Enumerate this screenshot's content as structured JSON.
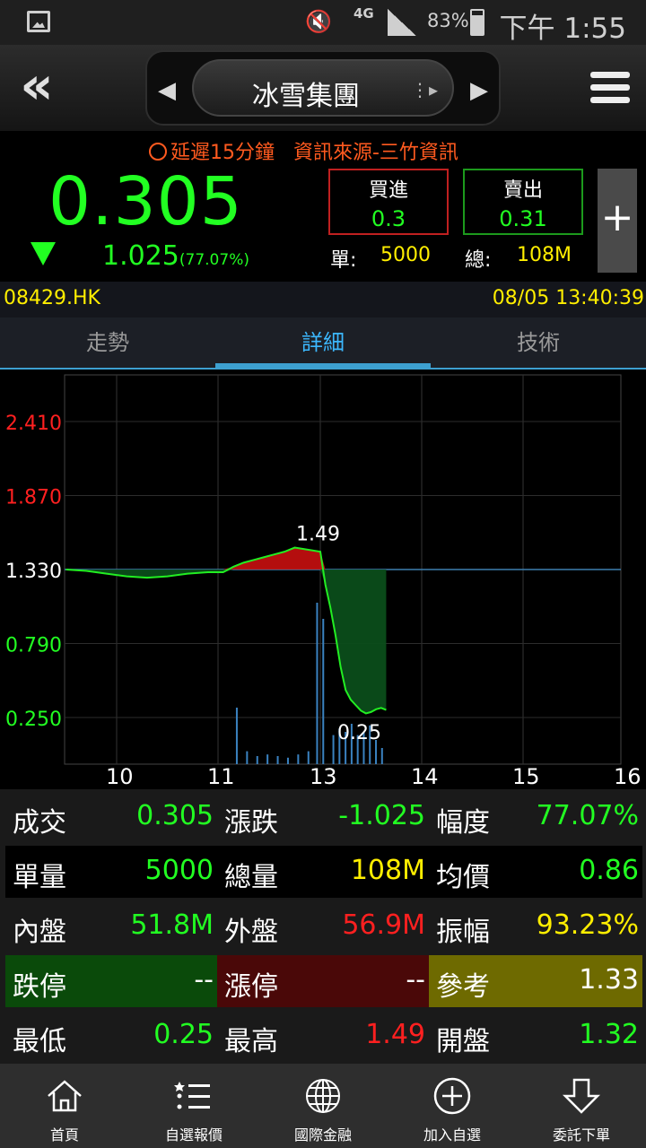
{
  "status_bar": {
    "network": "4G",
    "battery": "83%",
    "time": "下午 1:55"
  },
  "nav": {
    "title": "冰雪集團"
  },
  "quote": {
    "delay_note": "延遲15分鐘",
    "source_note": "資訊來源-三竹資訊",
    "price": "0.305",
    "change": "1.025",
    "change_pct": "(77.07%)",
    "buy_label": "買進",
    "buy_value": "0.3",
    "sell_label": "賣出",
    "sell_value": "0.31",
    "lot_label": "單:",
    "lot_value": "5000",
    "total_label": "總:",
    "total_value": "108M",
    "plus": "+"
  },
  "code_row": {
    "code": "08429.HK",
    "datetime": "08/05 13:40:39"
  },
  "tabs": [
    {
      "label": "走勢",
      "active": false
    },
    {
      "label": "詳細",
      "active": true
    },
    {
      "label": "技術",
      "active": false
    }
  ],
  "chart_data": {
    "type": "line",
    "y_ticks": [
      "2.410",
      "1.870",
      "1.330",
      "0.790",
      "0.250"
    ],
    "y_tick_colors": [
      "#ff2020",
      "#ff2020",
      "#ffffff",
      "#22ff22",
      "#22ff22"
    ],
    "x_ticks": [
      "10",
      "11",
      "13",
      "14",
      "15",
      "16"
    ],
    "ylim": [
      0.25,
      2.41
    ],
    "reference": 1.33,
    "high_label": "1.49",
    "low_label": "0.25",
    "price_series": {
      "x": [
        9.5,
        9.7,
        9.9,
        10.1,
        10.3,
        10.5,
        10.7,
        10.9,
        11.1,
        11.3,
        11.5,
        11.7,
        11.9,
        12.1,
        12.3,
        12.5,
        13.0,
        13.05,
        13.1,
        13.15,
        13.2,
        13.25,
        13.3,
        13.35,
        13.4,
        13.45,
        13.5,
        13.55,
        13.6,
        13.65
      ],
      "y": [
        1.33,
        1.32,
        1.3,
        1.28,
        1.27,
        1.28,
        1.3,
        1.31,
        1.31,
        1.35,
        1.38,
        1.4,
        1.42,
        1.44,
        1.46,
        1.49,
        1.46,
        1.22,
        1.05,
        0.85,
        0.62,
        0.45,
        0.38,
        0.34,
        0.3,
        0.28,
        0.29,
        0.31,
        0.32,
        0.305
      ]
    },
    "volume_bars": {
      "x": [
        11.35,
        11.55,
        11.75,
        11.95,
        12.15,
        12.35,
        12.55,
        12.75,
        12.92,
        13.02,
        13.12,
        13.18,
        13.24,
        13.3,
        13.36,
        13.42,
        13.48,
        13.54,
        13.6
      ],
      "v": [
        0.35,
        0.08,
        0.05,
        0.06,
        0.05,
        0.04,
        0.06,
        0.08,
        1.0,
        0.9,
        0.18,
        0.22,
        0.2,
        0.25,
        0.18,
        0.2,
        0.24,
        0.15,
        0.1
      ]
    }
  },
  "info": {
    "rows": [
      {
        "bg": "#1a1a1a",
        "cells": [
          {
            "k": "成交",
            "v": "0.305",
            "c": "green"
          },
          {
            "k": "漲跌",
            "v": "-1.025",
            "c": "green"
          },
          {
            "k": "幅度",
            "v": "77.07%",
            "c": "green"
          }
        ]
      },
      {
        "bg": "#000000",
        "cells": [
          {
            "k": "單量",
            "v": "5000",
            "c": "green"
          },
          {
            "k": "總量",
            "v": "108M",
            "c": "yellow"
          },
          {
            "k": "均價",
            "v": "0.86",
            "c": "green"
          }
        ]
      },
      {
        "bg": "#1a1a1a",
        "cells": [
          {
            "k": "內盤",
            "v": "51.8M",
            "c": "green"
          },
          {
            "k": "外盤",
            "v": "56.9M",
            "c": "red"
          },
          {
            "k": "振幅",
            "v": "93.23%",
            "c": "yellow"
          }
        ]
      },
      {
        "bg": "#000000",
        "cells": [
          {
            "k": "跌停",
            "v": "--",
            "c": "white",
            "bg": "#0a4a0a"
          },
          {
            "k": "漲停",
            "v": "--",
            "c": "white",
            "bg": "#4a0808"
          },
          {
            "k": "參考",
            "v": "1.33",
            "c": "white",
            "bg": "#6e6a00"
          }
        ]
      },
      {
        "bg": "#1a1a1a",
        "cells": [
          {
            "k": "最低",
            "v": "0.25",
            "c": "green"
          },
          {
            "k": "最高",
            "v": "1.49",
            "c": "red"
          },
          {
            "k": "開盤",
            "v": "1.32",
            "c": "green"
          }
        ]
      }
    ]
  },
  "bottom_nav": [
    {
      "label": "首頁",
      "icon": "home-icon"
    },
    {
      "label": "自選報價",
      "icon": "list-icon"
    },
    {
      "label": "國際金融",
      "icon": "globe-icon"
    },
    {
      "label": "加入自選",
      "icon": "add-circle-icon"
    },
    {
      "label": "委託下單",
      "icon": "order-icon"
    }
  ]
}
